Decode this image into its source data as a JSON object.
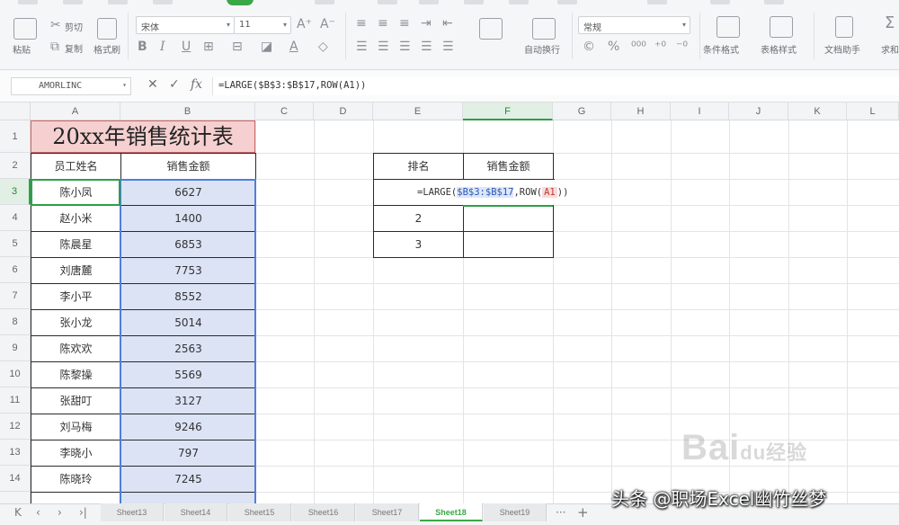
{
  "ribbon": {
    "left_labels": [
      "粘贴",
      "格式刷"
    ],
    "cut": "剪切",
    "copy": "复制",
    "font_name": "宋体",
    "font_size": "11",
    "wrap_text": "自动换行",
    "number_format": "常规",
    "conditional_format": "条件格式",
    "table_style": "表格样式",
    "doc_assistant": "文档助手",
    "other": "求和"
  },
  "formula_bar": {
    "name_box": "AMORLINC",
    "formula": "=LARGE($B$3:$B$17,ROW(A1))"
  },
  "columns": [
    "A",
    "B",
    "C",
    "D",
    "E",
    "F",
    "G",
    "H",
    "I",
    "J",
    "K",
    "L"
  ],
  "rows": [
    "1",
    "2",
    "3",
    "4",
    "5",
    "6",
    "7",
    "8",
    "9",
    "10",
    "11",
    "12",
    "13",
    "14"
  ],
  "sheet": {
    "title": "20xx年销售统计表",
    "header_name": "员工姓名",
    "header_amount": "销售金额",
    "records": [
      {
        "name": "陈小凤",
        "amount": "6627"
      },
      {
        "name": "赵小米",
        "amount": "1400"
      },
      {
        "name": "陈晨星",
        "amount": "6853"
      },
      {
        "name": "刘唐麓",
        "amount": "7753"
      },
      {
        "name": "李小平",
        "amount": "8552"
      },
      {
        "name": "张小龙",
        "amount": "5014"
      },
      {
        "name": "陈欢欢",
        "amount": "2563"
      },
      {
        "name": "陈黎操",
        "amount": "5569"
      },
      {
        "name": "张甜叮",
        "amount": "3127"
      },
      {
        "name": "刘马梅",
        "amount": "9246"
      },
      {
        "name": "李晓小",
        "amount": "797"
      },
      {
        "name": "陈晓玲",
        "amount": "7245"
      }
    ],
    "rank_header": "排名",
    "rank_amount_header": "销售金额",
    "rank_2": "2",
    "rank_3": "3",
    "editing": {
      "prefix": "=LARGE(",
      "range": "$B$3:$B$17",
      "middle": ",ROW(",
      "arg": "A1",
      "suffix": "))"
    }
  },
  "tabs": {
    "sheets": [
      "Sheet13",
      "Sheet14",
      "Sheet15",
      "Sheet16",
      "Sheet17",
      "Sheet18",
      "Sheet19"
    ],
    "active": "Sheet18",
    "more": "···",
    "add": "+"
  },
  "overlay": {
    "watermark": "Bai",
    "watermark_small": "du",
    "watermark_tail": "经验",
    "credit": "头条 @职场Excel幽竹丝梦"
  },
  "colors": {
    "accent": "#3aa845",
    "title_fill": "#f6d0d0",
    "amount_fill": "#dbe3f5",
    "selection_border": "#4f7fd8"
  }
}
